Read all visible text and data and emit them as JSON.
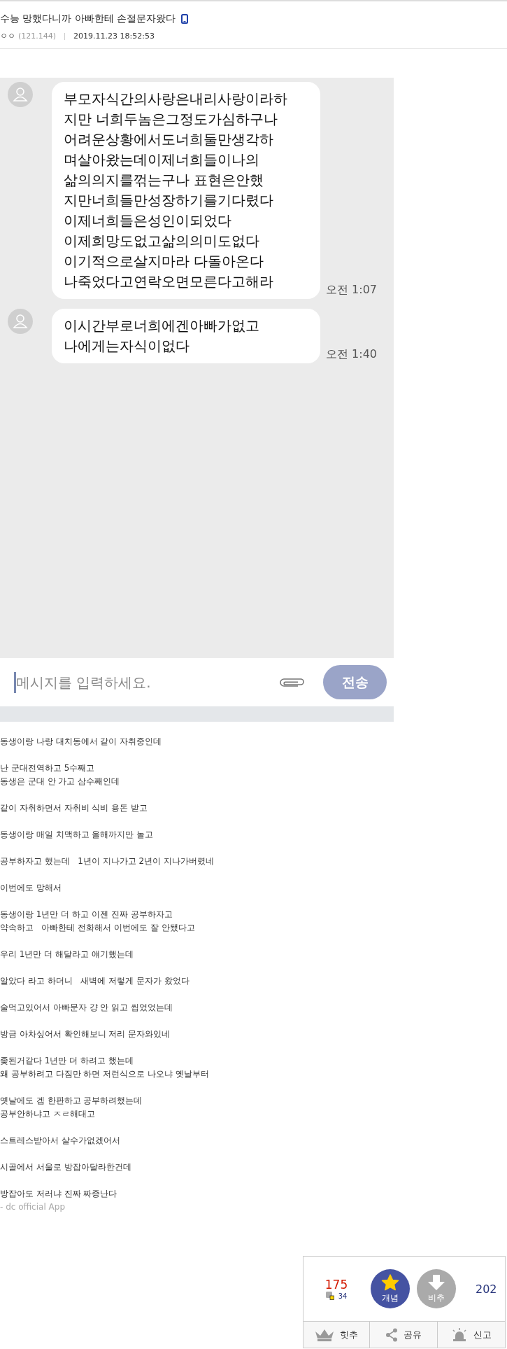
{
  "post": {
    "title": "수능 망했다니까 아빠한테 손절문자왔다",
    "mobile": true,
    "author": "ㅇㅇ",
    "ip": "(121.144)",
    "date": "2019.11.23 18:52:53"
  },
  "chat": {
    "messages": [
      {
        "lines": [
          "부모자식간의사랑은내리사랑이라하",
          "지만  너희두놈은그정도가심하구나",
          "어려운상황에서도너희둘만생각하",
          "며살아왔는데이제너희들이나의",
          "삶의의지를꺾는구나  표현은안했",
          "지만너희들만성장하기를기다렸다",
          "이제너희들은성인이되었다",
          "이제희망도없고삶의의미도없다",
          "이기적으로살지마라 다돌아온다",
          "나죽었다고연락오면모른다고해라"
        ],
        "time": "오전 1:07"
      },
      {
        "lines": [
          "이시간부로너희에겐아빠가없고",
          "나에게는자식이없다"
        ],
        "time": "오전 1:40"
      }
    ],
    "input": {
      "placeholder": "메시지를 입력하세요."
    },
    "send": {
      "label": "전송",
      "disabled": true
    }
  },
  "body": {
    "paragraphs": [
      [
        "동생이랑 나랑 대치동에서 같이 자취중인데"
      ],
      [
        "난 군대전역하고 5수째고",
        "동생은 군대 안 가고 삼수째인데"
      ],
      [
        "같이 자취하면서 자취비 식비 용돈 받고"
      ],
      [
        "동생이랑 매일 치맥하고 올해까지만 놀고"
      ],
      [
        "공부하자고 했는데   1년이 지나가고 2년이 지나가버렸네"
      ],
      [
        "이번에도 망해서"
      ],
      [
        "동생이랑 1년만 더 하고 이젠 진짜 공부하자고",
        "약속하고   아빠한테 전화해서 이번에도 잘 안됐다고"
      ],
      [
        "우리 1년만 더 해달라고 얘기했는데"
      ],
      [
        "알았다 라고 하더니   새벽에 저렇게 문자가 왔었다"
      ],
      [
        "술먹고있어서 아빠문자 걍 안 읽고 씹었었는데"
      ],
      [
        "방금 아차싶어서 확인해보니 저리 문자와있네"
      ],
      [
        "좆된거같다 1년만 더 하려고 했는데",
        "왜 공부하려고 다짐만 하면 저런식으로 나오냐 옛날부터"
      ],
      [
        "옛날에도 겜 한판하고 공부하려했는데",
        "공부안하냐고 ㅈㄹ해대고"
      ],
      [
        "스트레스받아서 살수가없겠어서"
      ],
      [
        "시골에서 서울로 방잡아달라한건데"
      ],
      [
        "방잡아도 저러냐 진짜 짜증난다"
      ]
    ],
    "signature": "- dc official App"
  },
  "vote": {
    "up_count": "175",
    "fix_count": "34",
    "up_label": "개념",
    "down_label": "비추",
    "down_count": "202",
    "actions": [
      {
        "kind": "crown",
        "label": "힛추"
      },
      {
        "kind": "share",
        "label": "공유"
      },
      {
        "kind": "siren",
        "label": "신고"
      }
    ]
  }
}
